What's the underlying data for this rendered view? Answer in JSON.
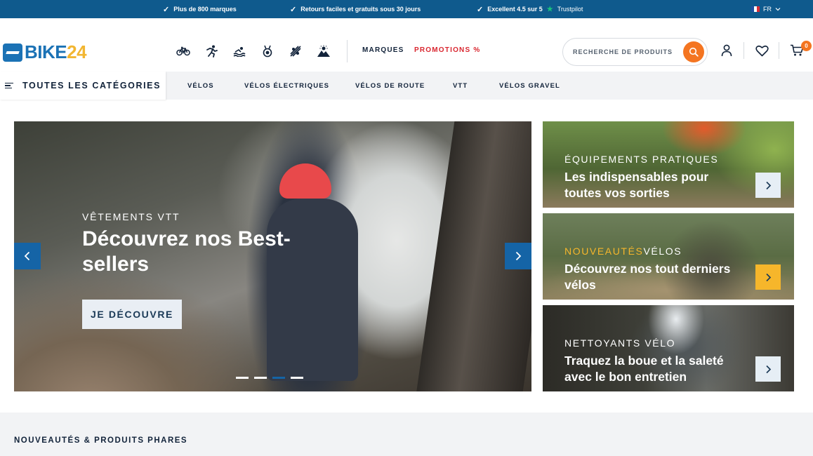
{
  "topbar": {
    "usps": [
      "Plus de 800 marques",
      "Retours faciles et gratuits sous 30 jours",
      "Excellent 4.5 sur 5"
    ],
    "trustpilot": "Trustpilot",
    "language": "FR"
  },
  "header": {
    "logo_text": "BIKE",
    "logo_number": "24",
    "sport_icons": [
      "bicycle-icon",
      "running-icon",
      "swimming-icon",
      "triathlon-medal-icon",
      "outdoor-climbing-icon",
      "mountain-sun-icon"
    ],
    "nav_brands": "MARQUES",
    "nav_promotions": "PROMOTIONS %",
    "search_placeholder": "RECHERCHE DE PRODUITS",
    "cart_count": "0",
    "colors": {
      "accent": "#f47521",
      "brand": "#1b72b5",
      "promo": "#d9262f",
      "topbar": "#0f5a8d"
    }
  },
  "categories": {
    "all_label": "TOUTES LES CATÉGORIES",
    "links": [
      "VÉLOS",
      "VÉLOS ÉLECTRIQUES",
      "VÉLOS DE ROUTE",
      "VTT",
      "VÉLOS GRAVEL"
    ]
  },
  "hero": {
    "eyebrow": "VÊTEMENTS VTT",
    "title": "Découvrez nos Best-sellers",
    "cta": "JE DÉCOUVRE",
    "slides": 4,
    "active_slide": 3
  },
  "banners": [
    {
      "eyebrow": "ÉQUIPEMENTS PRATIQUES",
      "eyebrow_highlight": "",
      "title": "Les indispensables pour toutes vos sorties"
    },
    {
      "eyebrow": "VÉLOS",
      "eyebrow_highlight": "NOUVEAUTÉS",
      "title": "Découvrez nos tout derniers vélos"
    },
    {
      "eyebrow": "NETTOYANTS VÉLO",
      "eyebrow_highlight": "",
      "title": "Traquez la boue et la saleté avec le bon entretien"
    }
  ],
  "section": {
    "heading": "NOUVEAUTÉS & PRODUITS PHARES"
  }
}
